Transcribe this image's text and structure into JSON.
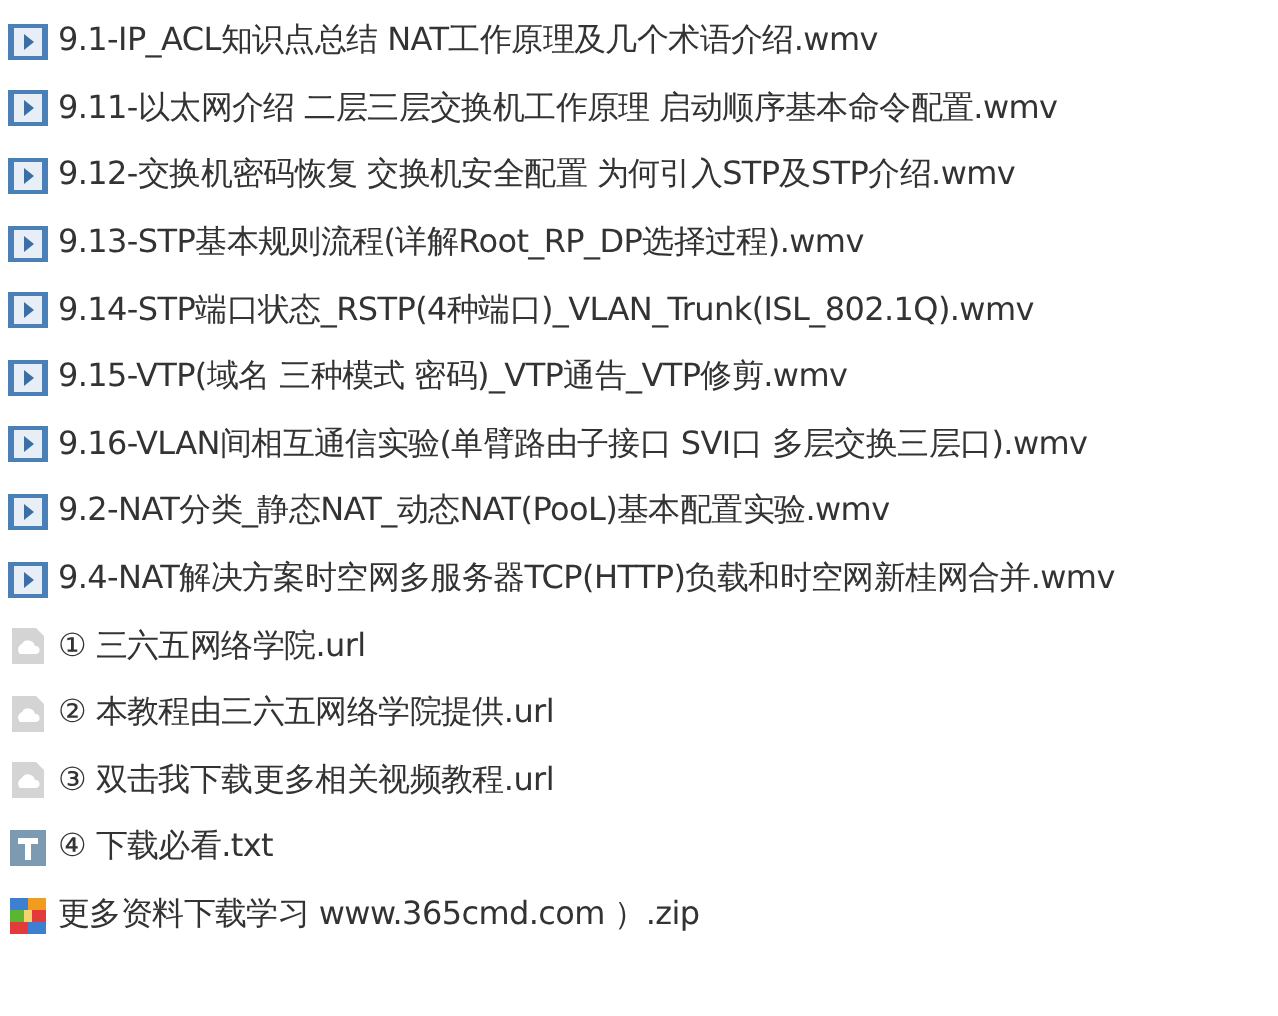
{
  "files": [
    {
      "name": "9.1-IP_ACL知识点总结 NAT工作原理及几个术语介绍.wmv",
      "kind": "video"
    },
    {
      "name": "9.11-以太网介绍 二层三层交换机工作原理 启动顺序基本命令配置.wmv",
      "kind": "video"
    },
    {
      "name": "9.12-交换机密码恢复 交换机安全配置 为何引入STP及STP介绍.wmv",
      "kind": "video"
    },
    {
      "name": "9.13-STP基本规则流程(详解Root_RP_DP选择过程).wmv",
      "kind": "video"
    },
    {
      "name": "9.14-STP端口状态_RSTP(4种端口)_VLAN_Trunk(ISL_802.1Q).wmv",
      "kind": "video"
    },
    {
      "name": "9.15-VTP(域名 三种模式 密码)_VTP通告_VTP修剪.wmv",
      "kind": "video"
    },
    {
      "name": "9.16-VLAN间相互通信实验(单臂路由子接口 SVI口 多层交换三层口).wmv",
      "kind": "video"
    },
    {
      "name": "9.2-NAT分类_静态NAT_动态NAT(PooL)基本配置实验.wmv",
      "kind": "video"
    },
    {
      "name": "9.4-NAT解决方案时空网多服务器TCP(HTTP)负载和时空网新桂网合并.wmv",
      "kind": "video"
    },
    {
      "name": "① 三六五网络学院.url",
      "kind": "url"
    },
    {
      "name": "② 本教程由三六五网络学院提供.url",
      "kind": "url"
    },
    {
      "name": "③ 双击我下载更多相关视频教程.url",
      "kind": "url"
    },
    {
      "name": "④ 下载必看.txt",
      "kind": "txt"
    },
    {
      "name": "更多资料下载学习 www.365cmd.com ）.zip",
      "kind": "zip"
    }
  ]
}
